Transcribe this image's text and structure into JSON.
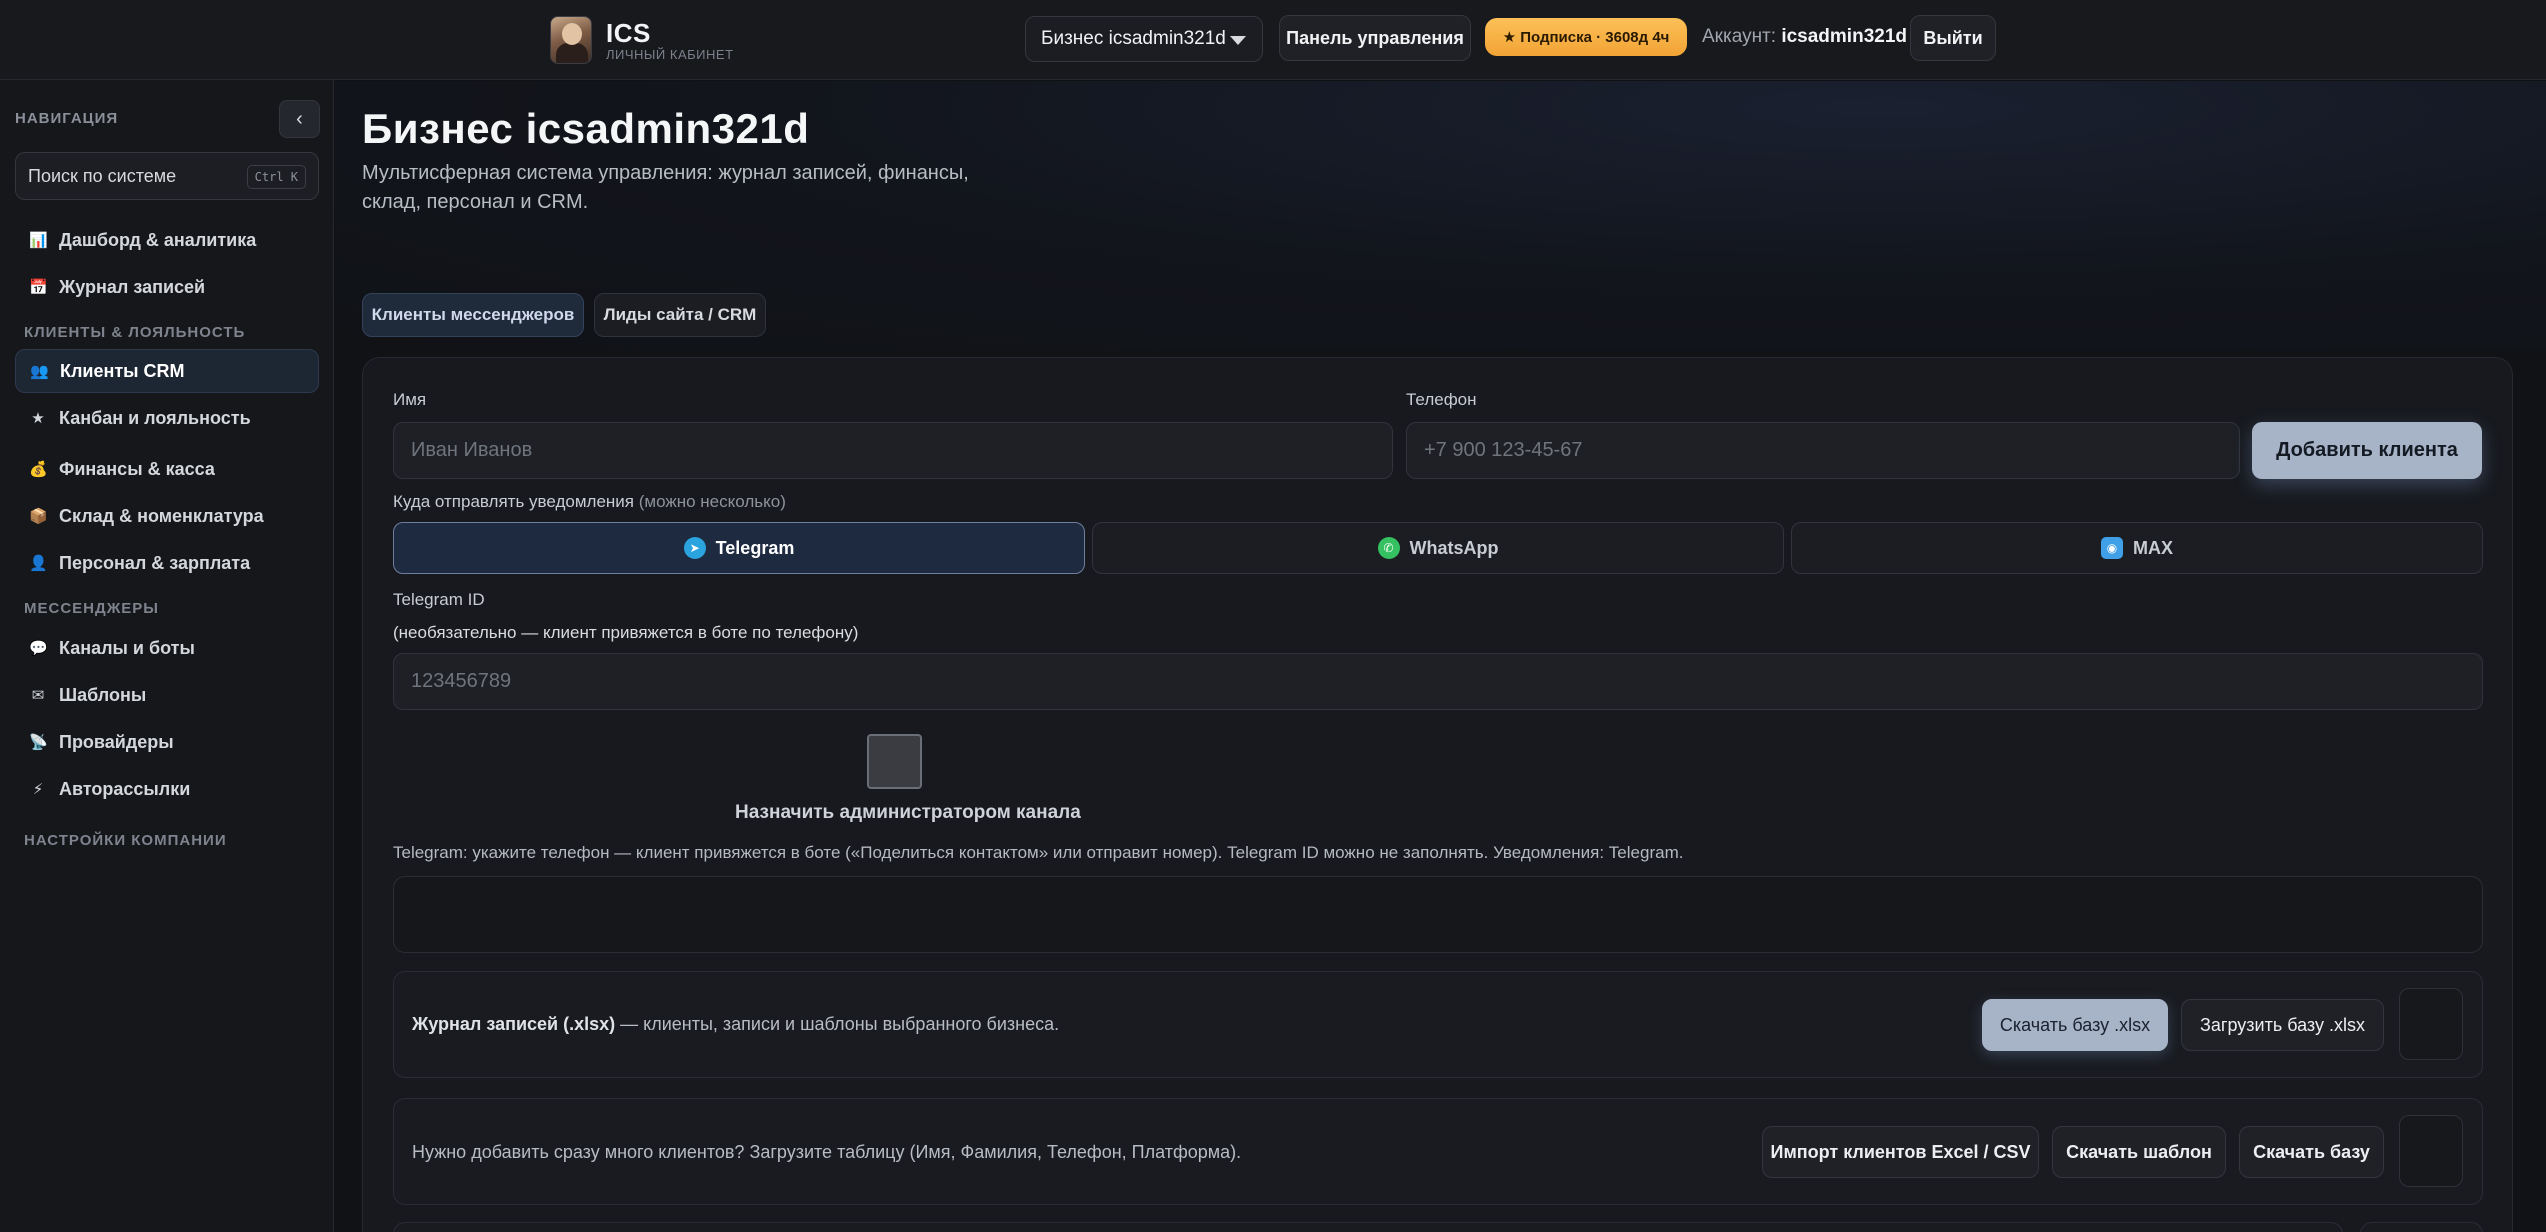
{
  "topbar": {
    "brand_name": "ICS",
    "brand_sub": "ЛИЧНЫЙ КАБИНЕТ",
    "business_select": "Бизнес icsadmin321d",
    "dashboard_button": "Панель управления",
    "subscription_badge": "★ Подписка · 3608д 4ч",
    "account_label": "Аккаунт:",
    "account_name": "icsadmin321d",
    "logout_button": "Выйти"
  },
  "sidebar": {
    "nav_header": "НАВИГАЦИЯ",
    "collapse_glyph": "‹",
    "search_label": "Поиск по системе",
    "search_shortcut": "Ctrl K",
    "items": [
      {
        "icon": "📊",
        "label": "Дашборд & аналитика"
      },
      {
        "icon": "📅",
        "label": "Журнал записей"
      },
      {
        "icon": "👥",
        "label": "Клиенты CRM"
      },
      {
        "icon": "★",
        "label": "Канбан и лояльность"
      },
      {
        "icon": "💰",
        "label": "Финансы & касса"
      },
      {
        "icon": "📦",
        "label": "Склад & номенклатура"
      },
      {
        "icon": "👤",
        "label": "Персонал & зарплата"
      },
      {
        "icon": "💬",
        "label": "Каналы и боты"
      },
      {
        "icon": "✉",
        "label": "Шаблоны"
      },
      {
        "icon": "📡",
        "label": "Провайдеры"
      },
      {
        "icon": "⚡",
        "label": "Авторассылки"
      }
    ],
    "sections": {
      "clients": "КЛИЕНТЫ & ЛОЯЛЬНОСТЬ",
      "messengers": "МЕССЕНДЖЕРЫ",
      "company": "НАСТРОЙКИ КОМПАНИИ"
    }
  },
  "main": {
    "title": "Бизнес icsadmin321d",
    "description": "Мультисферная система управления: журнал записей, финансы, склад, персонал и CRM.",
    "tabs": [
      {
        "label": "Клиенты мессенджеров"
      },
      {
        "label": "Лиды сайта / CRM"
      }
    ],
    "form": {
      "name_label": "Имя",
      "name_placeholder": "Иван Иванов",
      "phone_label": "Телефон",
      "phone_placeholder": "+7 900 123-45-67",
      "add_button": "Добавить клиента",
      "notify_label": "Куда отправлять уведомления",
      "notify_hint": "(можно несколько)",
      "channels": [
        {
          "label": "Telegram",
          "color": "#2aa3df"
        },
        {
          "label": "WhatsApp",
          "color": "#35c061"
        },
        {
          "label": "MAX",
          "color": "#3fa0e8"
        }
      ],
      "telegram_id_label": "Telegram ID",
      "telegram_id_hint": "(необязательно — клиент привяжется в боте по телефону)",
      "telegram_id_placeholder": "123456789",
      "admin_checkbox_label": "Назначить администратором канала",
      "telegram_hint": "Telegram: укажите телефон — клиент привяжется в боте («Поделиться контактом» или отправит номер). Telegram ID можно не заполнять. Уведомления: Telegram."
    },
    "journal_panel": {
      "title": "Журнал записей (.xlsx)",
      "text": " — клиенты, записи и шаблоны выбранного бизнеса.",
      "download_button": "Скачать базу .xlsx",
      "upload_button": "Загрузить базу .xlsx"
    },
    "import_panel": {
      "text": "Нужно добавить сразу много клиентов? Загрузите таблицу (Имя, Фамилия, Телефон, Платформа).",
      "import_button": "Импорт клиентов Excel / CSV",
      "template_button": "Скачать шаблон",
      "download_button": "Скачать базу"
    }
  }
}
